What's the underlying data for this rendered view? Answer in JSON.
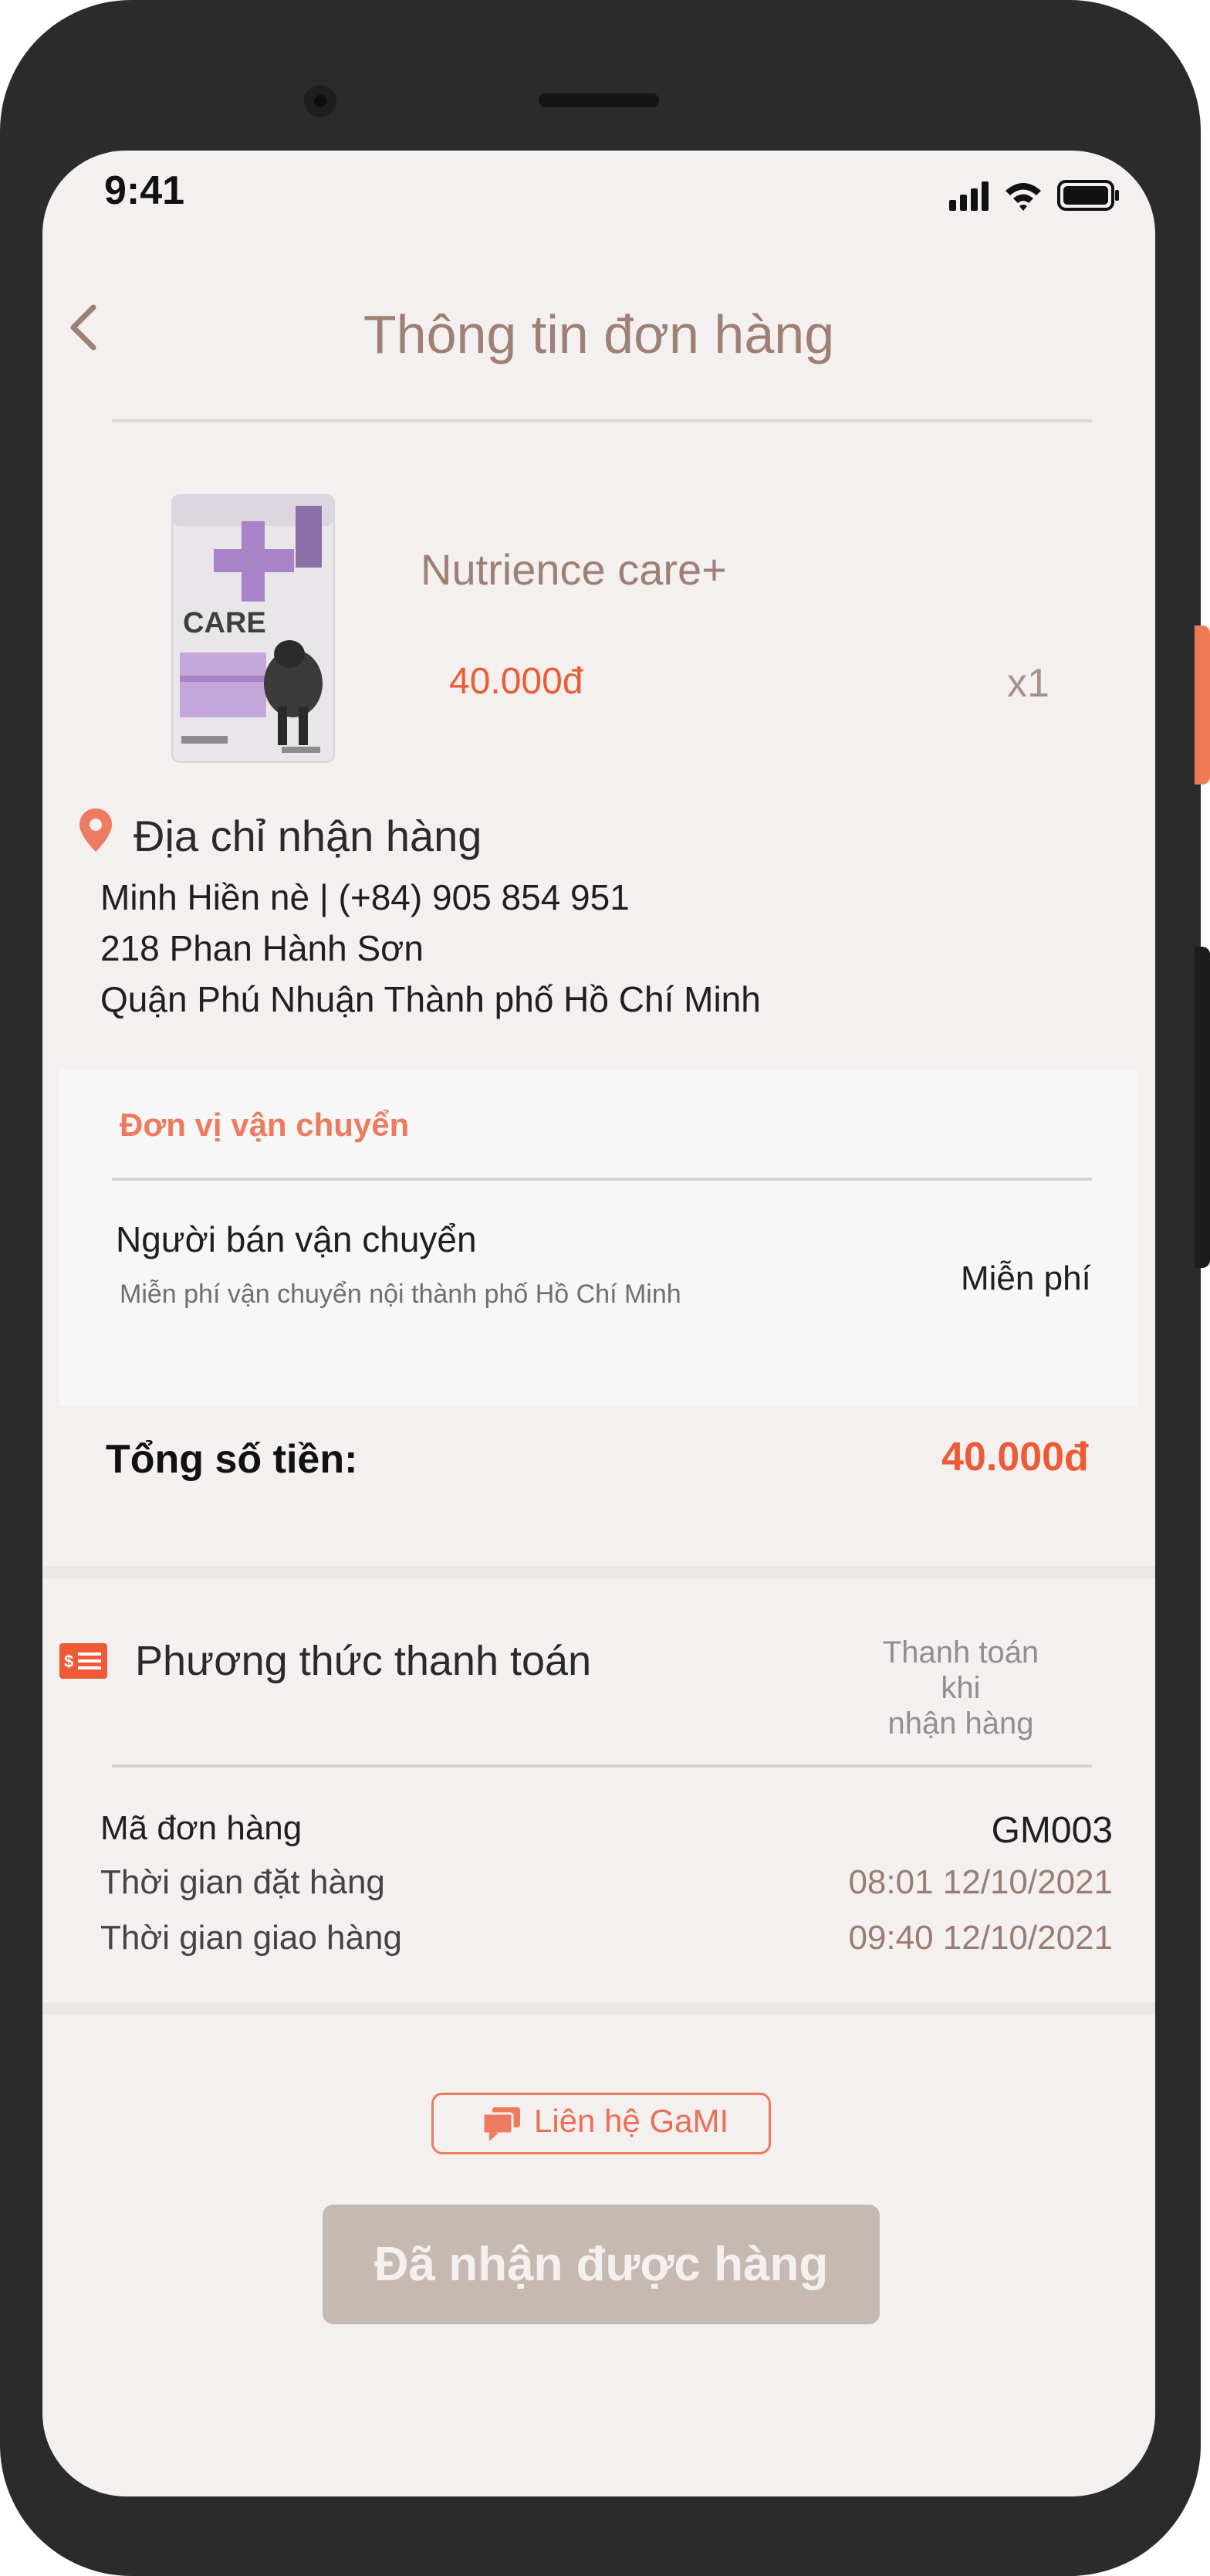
{
  "status_bar": {
    "time": "9:41"
  },
  "header": {
    "title": "Thông tin đơn hàng"
  },
  "product": {
    "name": "Nutrience care+",
    "price": "40.000đ",
    "quantity": "x1",
    "image_brand": "CARE"
  },
  "address": {
    "title": "Địa chỉ nhận hàng",
    "lines": [
      "Minh Hiền nè | (+84) 905 854 951",
      "218 Phan Hành Sơn",
      "Quận Phú Nhuận Thành phố Hồ Chí Minh"
    ]
  },
  "shipping": {
    "title": "Đơn vị vận chuyển",
    "provider": "Người bán vận chuyển",
    "note": "Miễn phí vận chuyển nội thành phố Hồ Chí Minh",
    "fee": "Miễn phí"
  },
  "total": {
    "label": "Tổng số tiền:",
    "value": "40.000đ"
  },
  "payment": {
    "label": "Phương thức thanh toán",
    "value_lines": [
      "Thanh toán khi",
      "nhận hàng"
    ]
  },
  "order_info": {
    "rows": [
      {
        "label": "Mã đơn hàng",
        "value": "GM003"
      },
      {
        "label": "Thời gian đặt hàng",
        "value": "08:01 12/10/2021"
      },
      {
        "label": "Thời gian giao hàng",
        "value": "09:40 12/10/2021"
      }
    ]
  },
  "actions": {
    "contact_label": "Liên hệ GaMI",
    "received_label": "Đã nhận được hàng"
  },
  "colors": {
    "accent": "#ec5b36",
    "title_brown": "#9d8076",
    "button_disabled": "#c5b9b2",
    "screen_bg": "#f4f0ef"
  }
}
